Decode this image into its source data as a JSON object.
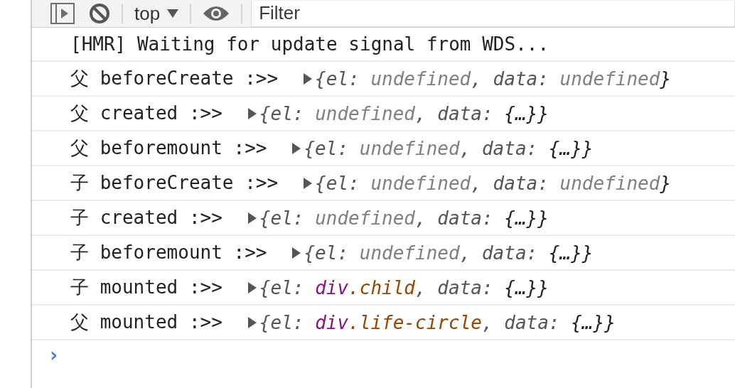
{
  "toolbar": {
    "context": "top",
    "filter": {
      "placeholder": "Filter"
    }
  },
  "messages": [
    {
      "text": "[HMR] Waiting for update signal from WDS..."
    },
    {
      "text": "父 beforeCreate :>>",
      "object": {
        "expanded": false,
        "parts": [
          {
            "text": "{el: ",
            "kind": "key"
          },
          {
            "text": "undefined",
            "kind": "undefined"
          },
          {
            "text": ", data: ",
            "kind": "key"
          },
          {
            "text": "undefined",
            "kind": "undefined"
          },
          {
            "text": "}",
            "kind": "plain"
          }
        ]
      }
    },
    {
      "text": "父 created :>>",
      "object": {
        "expanded": false,
        "parts": [
          {
            "text": "{el: ",
            "kind": "key"
          },
          {
            "text": "undefined",
            "kind": "undefined"
          },
          {
            "text": ", data: ",
            "kind": "key"
          },
          {
            "text": "{…}}",
            "kind": "plain"
          }
        ]
      }
    },
    {
      "text": "父 beforemount :>>",
      "object": {
        "expanded": false,
        "parts": [
          {
            "text": "{el: ",
            "kind": "key"
          },
          {
            "text": "undefined",
            "kind": "undefined"
          },
          {
            "text": ", data: ",
            "kind": "key"
          },
          {
            "text": "{…}}",
            "kind": "plain"
          }
        ]
      }
    },
    {
      "text": "子 beforeCreate :>>",
      "object": {
        "expanded": false,
        "parts": [
          {
            "text": "{el: ",
            "kind": "key"
          },
          {
            "text": "undefined",
            "kind": "undefined"
          },
          {
            "text": ", data: ",
            "kind": "key"
          },
          {
            "text": "undefined",
            "kind": "undefined"
          },
          {
            "text": "}",
            "kind": "plain"
          }
        ]
      }
    },
    {
      "text": "子 created :>>",
      "object": {
        "expanded": false,
        "parts": [
          {
            "text": "{el: ",
            "kind": "key"
          },
          {
            "text": "undefined",
            "kind": "undefined"
          },
          {
            "text": ", data: ",
            "kind": "key"
          },
          {
            "text": "{…}}",
            "kind": "plain"
          }
        ]
      }
    },
    {
      "text": "子 beforemount :>>",
      "object": {
        "expanded": false,
        "parts": [
          {
            "text": "{el: ",
            "kind": "key"
          },
          {
            "text": "undefined",
            "kind": "undefined"
          },
          {
            "text": ", data: ",
            "kind": "key"
          },
          {
            "text": "{…}}",
            "kind": "plain"
          }
        ]
      }
    },
    {
      "text": "子 mounted :>>",
      "object": {
        "expanded": false,
        "parts": [
          {
            "text": "{el: ",
            "kind": "key"
          },
          {
            "text": "div",
            "kind": "tag"
          },
          {
            "text": ".child",
            "kind": "class"
          },
          {
            "text": ", data: ",
            "kind": "key"
          },
          {
            "text": "{…}}",
            "kind": "plain"
          }
        ]
      }
    },
    {
      "text": "父 mounted :>>",
      "object": {
        "expanded": false,
        "parts": [
          {
            "text": "{el: ",
            "kind": "key"
          },
          {
            "text": "div",
            "kind": "tag"
          },
          {
            "text": ".life-circle",
            "kind": "class"
          },
          {
            "text": ", data: ",
            "kind": "key"
          },
          {
            "text": "{…}}",
            "kind": "plain"
          }
        ]
      }
    }
  ],
  "prompt": {
    "symbol": "›"
  }
}
